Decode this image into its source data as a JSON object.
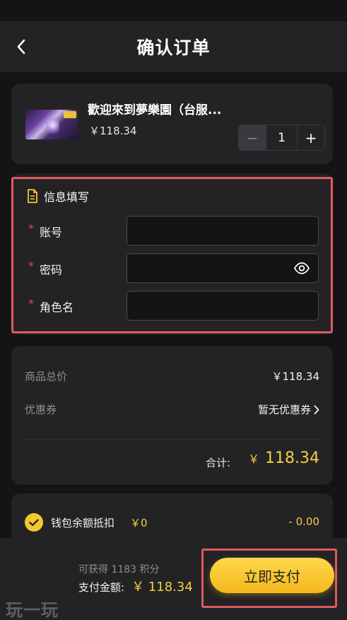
{
  "header": {
    "title": "确认订单"
  },
  "product": {
    "name": "歡迎來到夢樂園（台服...",
    "price": "￥118.34",
    "quantity": "1",
    "minus_label": "−",
    "plus_label": "+"
  },
  "info_form": {
    "title": "信息填写",
    "required_mark": "*",
    "fields": [
      {
        "label": "账号",
        "value": ""
      },
      {
        "label": "密码",
        "value": ""
      },
      {
        "label": "角色名",
        "value": ""
      }
    ]
  },
  "summary": {
    "goods_total_label": "商品总价",
    "goods_total_value": "￥118.34",
    "coupon_label": "优惠券",
    "coupon_value": "暂无优惠券",
    "total_label": "合计:",
    "total_currency": "￥",
    "total_value": "118.34"
  },
  "wallet": {
    "label": "钱包余额抵扣",
    "amount": "￥0",
    "deduct": "- 0.00"
  },
  "bottom_bar": {
    "points_text": "可获得 1183 积分",
    "pay_amount_label": "支付金额:",
    "pay_amount_value": "￥ 118.34",
    "pay_button_label": "立即支付"
  },
  "watermark": "玩一玩",
  "colors": {
    "accent": "#f5c72e",
    "highlight": "#e05a5e",
    "required": "#e24a4a",
    "card": "#232326",
    "background": "#141416"
  }
}
